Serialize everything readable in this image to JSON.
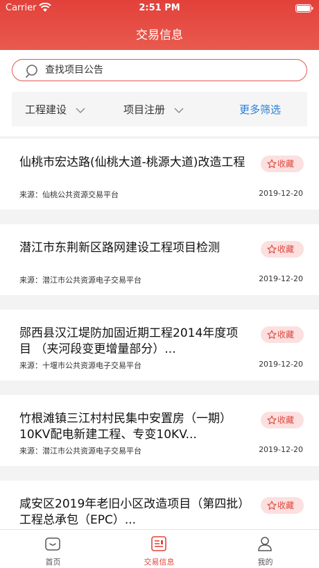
{
  "status_bar": {
    "carrier": "Carrier",
    "time": "2:51 PM"
  },
  "nav": {
    "title": "交易信息"
  },
  "search": {
    "placeholder": "查找项目公告"
  },
  "filters": {
    "engineering": "工程建设",
    "project_registration": "项目注册",
    "more": "更多筛选"
  },
  "favorite_label": "收藏",
  "items": [
    {
      "title": "仙桃市宏达路(仙桃大道-桃源大道)改造工程",
      "source": "来源：仙桃公共资源交易平台",
      "date": "2019-12-20"
    },
    {
      "title": "潜江市东荆新区路网建设工程项目检测",
      "source": "来源：潜江市公共资源电子交易平台",
      "date": "2019-12-20"
    },
    {
      "title": "郧西县汉江堤防加固近期工程2014年度项目 （夹河段变更增量部分）...",
      "source": "来源：十堰市公共资源电子交易平台",
      "date": "2019-12-20"
    },
    {
      "title": "竹根滩镇三江村村民集中安置房（一期）10KV配电新建工程、专变10KV...",
      "source": "来源：潜江市公共资源电子交易平台",
      "date": "2019-12-20"
    },
    {
      "title": "咸安区2019年老旧小区改造项目（第四批）工程总承包（EPC）...",
      "source": "",
      "date": ""
    }
  ],
  "tabbar": {
    "home": "首页",
    "trade": "交易信息",
    "mine": "我的"
  },
  "colors": {
    "brand_red": "#e2413a",
    "link_blue": "#2a7fd8",
    "fav_bg": "#fbe0df"
  }
}
